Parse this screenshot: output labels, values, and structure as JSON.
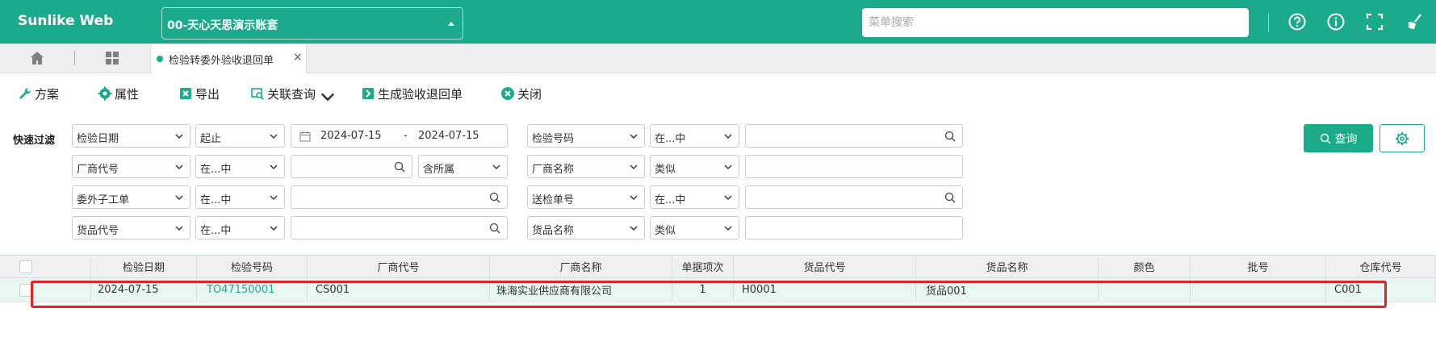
{
  "app": {
    "brand": "Sunlike Web",
    "account": "00-天心天思演示账套",
    "menu_search_placeholder": "菜单搜索",
    "top_icons": [
      "help-circle-icon",
      "info-icon",
      "fullscreen-icon",
      "broom-icon"
    ]
  },
  "tabs": {
    "home_icon": "home-icon",
    "apps_icon": "grid-apps-icon",
    "active_tab": "检验转委外验收退回单",
    "close_glyph": "×"
  },
  "toolbar": {
    "scheme": "方案",
    "properties": "属性",
    "export": "导出",
    "related_query": "关联查询",
    "generate": "生成验收退回单",
    "close": "关闭"
  },
  "filter": {
    "label": "快速过滤",
    "rows": [
      {
        "field1": "检验日期",
        "op1": "起止",
        "date_from": "2024-07-15",
        "date_sep": "-",
        "date_to": "2024-07-15",
        "field2": "检验号码",
        "op2": "在...中",
        "value2": ""
      },
      {
        "field1": "厂商代号",
        "op1": "在...中",
        "value1": "",
        "extra": "含所属",
        "field2": "厂商名称",
        "op2": "类似",
        "value2": ""
      },
      {
        "field1": "委外子工单",
        "op1": "在...中",
        "value1": "",
        "field2": "送检单号",
        "op2": "在...中",
        "value2": ""
      },
      {
        "field1": "货品代号",
        "op1": "在...中",
        "value1": "",
        "field2": "货品名称",
        "op2": "类似",
        "value2": ""
      }
    ],
    "query_button": "查询",
    "settings_icon": "gear-icon"
  },
  "grid": {
    "columns": [
      "检验日期",
      "检验号码",
      "厂商代号",
      "厂商名称",
      "单据项次",
      "货品代号",
      "货品名称",
      "颜色",
      "批号",
      "仓库代号"
    ],
    "rows": [
      {
        "检验日期": "2024-07-15",
        "检验号码": "TO47150001",
        "厂商代号": "CS001",
        "厂商名称": "珠海实业供应商有限公司",
        "单据项次": "1",
        "货品代号": "H0001",
        "货品名称": "货品001",
        "颜色": "",
        "批号": "",
        "仓库代号": "C001"
      }
    ]
  },
  "colors": {
    "brand": "#1bab8a",
    "highlight": "#e02424",
    "row_bg": "#e9f7f2"
  }
}
